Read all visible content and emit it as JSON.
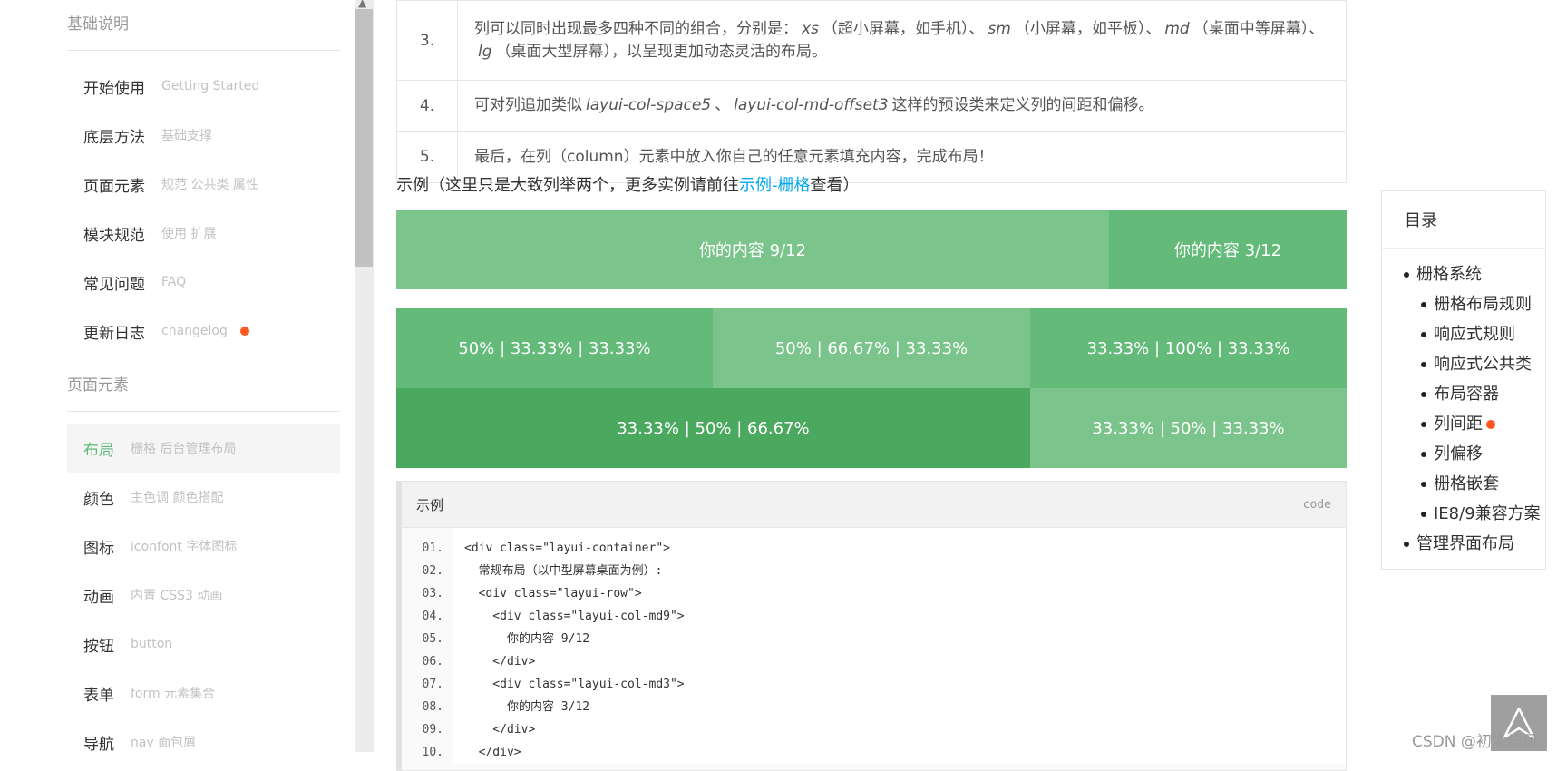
{
  "sidebar": {
    "section1_heading": "基础说明",
    "section1_items": [
      {
        "label": "开始使用",
        "sub": "Getting Started"
      },
      {
        "label": "底层方法",
        "sub": "基础支撑"
      },
      {
        "label": "页面元素",
        "sub": "规范 公共类 属性"
      },
      {
        "label": "模块规范",
        "sub": "使用 扩展"
      },
      {
        "label": "常见问题",
        "sub": "FAQ"
      },
      {
        "label": "更新日志",
        "sub": "changelog"
      }
    ],
    "section2_heading": "页面元素",
    "section2_items": [
      {
        "label": "布局",
        "sub": "栅格 后台管理布局"
      },
      {
        "label": "颜色",
        "sub": "主色调 颜色搭配"
      },
      {
        "label": "图标",
        "sub": "iconfont 字体图标"
      },
      {
        "label": "动画",
        "sub": "内置 CSS3 动画"
      },
      {
        "label": "按钮",
        "sub": "button"
      },
      {
        "label": "表单",
        "sub": "form 元素集合"
      },
      {
        "label": "导航",
        "sub": "nav 面包屑"
      }
    ]
  },
  "steps": [
    {
      "num": "3.",
      "t1": "列可以同时出现最多四种不同的组合，分别是：",
      "xs": "xs",
      "t2": "（超小屏幕，如手机）、",
      "sm": "sm",
      "t3": "（小屏幕，如平板）、",
      "md": "md",
      "t4": "（桌面中等屏幕）、",
      "lg": "lg",
      "t5": "（桌面大型屏幕），以呈现更加动态灵活的布局。"
    },
    {
      "num": "4.",
      "t1": "可对列追加类似",
      "c1": "layui-col-space5",
      "t2": "、",
      "c2": "layui-col-md-offset3",
      "t3": "这样的预设类来定义列的间距和偏移。"
    },
    {
      "num": "5.",
      "t1": "最后，在列（column）元素中放入你自己的任意元素填充内容，完成布局！"
    }
  ],
  "example": {
    "prefix": "示例（这里只是大致列举两个，更多实例请前往",
    "link": "示例-栅格",
    "suffix": "查看）"
  },
  "grid": {
    "row1": [
      "你的内容 9/12",
      "你的内容 3/12"
    ],
    "row2": [
      "50% | 33.33% | 33.33%",
      "50% | 66.67% | 33.33%",
      "33.33% | 100% | 33.33%"
    ],
    "row3": [
      "33.33% | 50% | 66.67%",
      "33.33% | 50% | 33.33%"
    ],
    "colors": {
      "light": "#7bc48b",
      "mid": "#63ba79",
      "dark": "#4ba85f"
    }
  },
  "code": {
    "title": "示例",
    "lang": "code",
    "line_numbers": [
      "01.",
      "02.",
      "03.",
      "04.",
      "05.",
      "06.",
      "07.",
      "08.",
      "09.",
      "10."
    ],
    "lines": [
      "<div class=\"layui-container\">",
      "  常规布局（以中型屏幕桌面为例）:",
      "  <div class=\"layui-row\">",
      "    <div class=\"layui-col-md9\">",
      "      你的内容 9/12",
      "    </div>",
      "    <div class=\"layui-col-md3\">",
      "      你的内容 3/12",
      "    </div>",
      "  </div>"
    ]
  },
  "toc": {
    "title": "目录",
    "items": [
      {
        "label": "栅格系统",
        "level": 1
      },
      {
        "label": "栅格布局规则",
        "level": 2
      },
      {
        "label": "响应式规则",
        "level": 2
      },
      {
        "label": "响应式公共类",
        "level": 2
      },
      {
        "label": "布局容器",
        "level": 2
      },
      {
        "label": "列间距",
        "level": 2,
        "dot": true
      },
      {
        "label": "列偏移",
        "level": 2
      },
      {
        "label": "栅格嵌套",
        "level": 2
      },
      {
        "label": "IE8/9兼容方案",
        "level": 2
      },
      {
        "label": "管理界面布局",
        "level": 1
      }
    ]
  },
  "watermark": "CSDN @初尘屿风",
  "accent_color": "#5fb878",
  "badge_color": "#ff5722",
  "link_color": "#01aaed"
}
